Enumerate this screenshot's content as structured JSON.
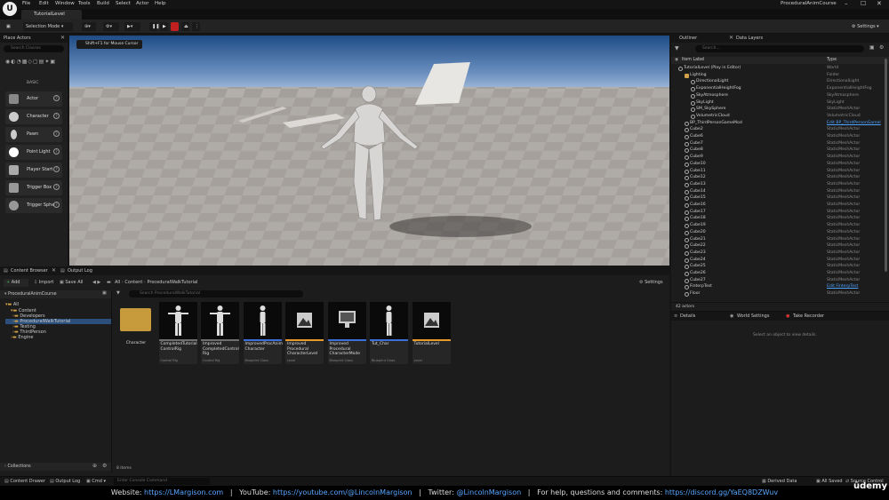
{
  "menu": {
    "items": [
      "File",
      "Edit",
      "Window",
      "Tools",
      "Build",
      "Select",
      "Actor",
      "Help"
    ],
    "project_title": "ProceduralAnimCourse"
  },
  "tabs": {
    "level_tab": "TutorialLevel"
  },
  "toolbar": {
    "mode": "Selection Mode",
    "settings": "Settings"
  },
  "viewport": {
    "hint": "Shift+F1 for Mouse Cursor"
  },
  "place_actors": {
    "title": "Place Actors",
    "search_placeholder": "Search Classes",
    "category": "BASIC",
    "items": [
      "Actor",
      "Character",
      "Pawn",
      "Point Light",
      "Player Start",
      "Trigger Box",
      "Trigger Sphe"
    ]
  },
  "outliner": {
    "tabs": [
      "Outliner",
      "Data Layers"
    ],
    "search_placeholder": "Search...",
    "col_label": "Item Label",
    "col_type": "Type",
    "rows": [
      {
        "name": "TutorialLevel (Play in Editor)",
        "type": "World",
        "indent": 0
      },
      {
        "name": "Lighting",
        "type": "Folder",
        "indent": 1
      },
      {
        "name": "DirectionalLight",
        "type": "DirectionalLight",
        "indent": 2
      },
      {
        "name": "ExponentialHeightFog",
        "type": "ExponentialHeightFog",
        "indent": 2
      },
      {
        "name": "SkyAtmosphere",
        "type": "SkyAtmosphere",
        "indent": 2
      },
      {
        "name": "SkyLight",
        "type": "SkyLight",
        "indent": 2
      },
      {
        "name": "SM_SkySphere",
        "type": "StaticMeshActor",
        "indent": 2
      },
      {
        "name": "VolumetricCloud",
        "type": "VolumetricCloud",
        "indent": 2
      },
      {
        "name": "BP_ThirdPersonGameMod",
        "type": "Edit BP_ThirdPersonGamel",
        "indent": 1,
        "link": true
      },
      {
        "name": "Cube2",
        "type": "StaticMeshActor",
        "indent": 1
      },
      {
        "name": "Cube6",
        "type": "StaticMeshActor",
        "indent": 1
      },
      {
        "name": "Cube7",
        "type": "StaticMeshActor",
        "indent": 1
      },
      {
        "name": "Cube8",
        "type": "StaticMeshActor",
        "indent": 1
      },
      {
        "name": "Cube9",
        "type": "StaticMeshActor",
        "indent": 1
      },
      {
        "name": "Cube10",
        "type": "StaticMeshActor",
        "indent": 1
      },
      {
        "name": "Cube11",
        "type": "StaticMeshActor",
        "indent": 1
      },
      {
        "name": "Cube12",
        "type": "StaticMeshActor",
        "indent": 1
      },
      {
        "name": "Cube13",
        "type": "StaticMeshActor",
        "indent": 1
      },
      {
        "name": "Cube14",
        "type": "StaticMeshActor",
        "indent": 1
      },
      {
        "name": "Cube15",
        "type": "StaticMeshActor",
        "indent": 1
      },
      {
        "name": "Cube16",
        "type": "StaticMeshActor",
        "indent": 1
      },
      {
        "name": "Cube17",
        "type": "StaticMeshActor",
        "indent": 1
      },
      {
        "name": "Cube18",
        "type": "StaticMeshActor",
        "indent": 1
      },
      {
        "name": "Cube19",
        "type": "StaticMeshActor",
        "indent": 1
      },
      {
        "name": "Cube20",
        "type": "StaticMeshActor",
        "indent": 1
      },
      {
        "name": "Cube21",
        "type": "StaticMeshActor",
        "indent": 1
      },
      {
        "name": "Cube22",
        "type": "StaticMeshActor",
        "indent": 1
      },
      {
        "name": "Cube23",
        "type": "StaticMeshActor",
        "indent": 1
      },
      {
        "name": "Cube24",
        "type": "StaticMeshActor",
        "indent": 1
      },
      {
        "name": "Cube25",
        "type": "StaticMeshActor",
        "indent": 1
      },
      {
        "name": "Cube26",
        "type": "StaticMeshActor",
        "indent": 1
      },
      {
        "name": "Cube27",
        "type": "StaticMeshActor",
        "indent": 1
      },
      {
        "name": "FinterpTest",
        "type": "Edit FinterpTest",
        "indent": 1,
        "link": true
      },
      {
        "name": "Floor",
        "type": "StaticMeshActor",
        "indent": 1
      }
    ],
    "count": "42 actors"
  },
  "details": {
    "tabs": [
      "Details",
      "World Settings",
      "Take Recorder"
    ],
    "empty": "Select an object to view details."
  },
  "content_browser": {
    "tabs": [
      "Content Browser",
      "Output Log"
    ],
    "add": "Add",
    "import": "Import",
    "save_all": "Save All",
    "path": [
      "All",
      "Content",
      "ProceduralWalkTutorial"
    ],
    "settings": "Settings",
    "project": "ProceduralAnimCourse",
    "search_placeholder": "Search ProceduralWalkTutorial",
    "tree": [
      "All",
      "Content",
      "Developers",
      "ProceduralWalkTutorial",
      "Testing",
      "ThirdPerson",
      "Engine"
    ],
    "collections": "Collections",
    "items_count": "8 items",
    "assets": [
      {
        "label": "Character",
        "type": "",
        "kind": "folder",
        "bar": "#1c1c1c"
      },
      {
        "label": "CompletedTutorial ControlRig",
        "type": "Control Rig",
        "kind": "figure",
        "bar": "#6f6f6f"
      },
      {
        "label": "Improved CompletedControl Rig",
        "type": "Control Rig",
        "kind": "figure",
        "bar": "#6f6f6f"
      },
      {
        "label": "ImprovedProcAnim Character",
        "type": "Blueprint Class",
        "kind": "figure-side",
        "bar": "#3a6fd8"
      },
      {
        "label": "Improved Procedural CharacterLevel",
        "type": "Level",
        "kind": "level",
        "bar": "#e59a2a"
      },
      {
        "label": "Improved Procedural CharacterMode",
        "type": "Blueprint Class",
        "kind": "monitor",
        "bar": "#3a6fd8"
      },
      {
        "label": "Tut_Char",
        "type": "Blueprint Class",
        "kind": "figure-side",
        "bar": "#3a6fd8"
      },
      {
        "label": "TutorialLevel",
        "type": "Level",
        "kind": "level",
        "bar": "#e59a2a"
      }
    ]
  },
  "status": {
    "content_drawer": "Content Drawer",
    "output_log": "Output Log",
    "cmd": "Cmd",
    "console_placeholder": "Enter Console Command",
    "derived": "Derived Data",
    "all_saved": "All Saved",
    "source": "Source Control"
  },
  "footer": {
    "website_label": "Website:",
    "website": "https://LMargison.com",
    "youtube_label": "YouTube:",
    "youtube": "https://youtube.com/@LincolnMargison",
    "twitter_label": "Twitter:",
    "twitter": "@LincolnMargison",
    "help_label": "For help, questions and comments:",
    "discord": "https://discord.gg/YaEQ8DZWuv",
    "brand": "ūdemy"
  }
}
